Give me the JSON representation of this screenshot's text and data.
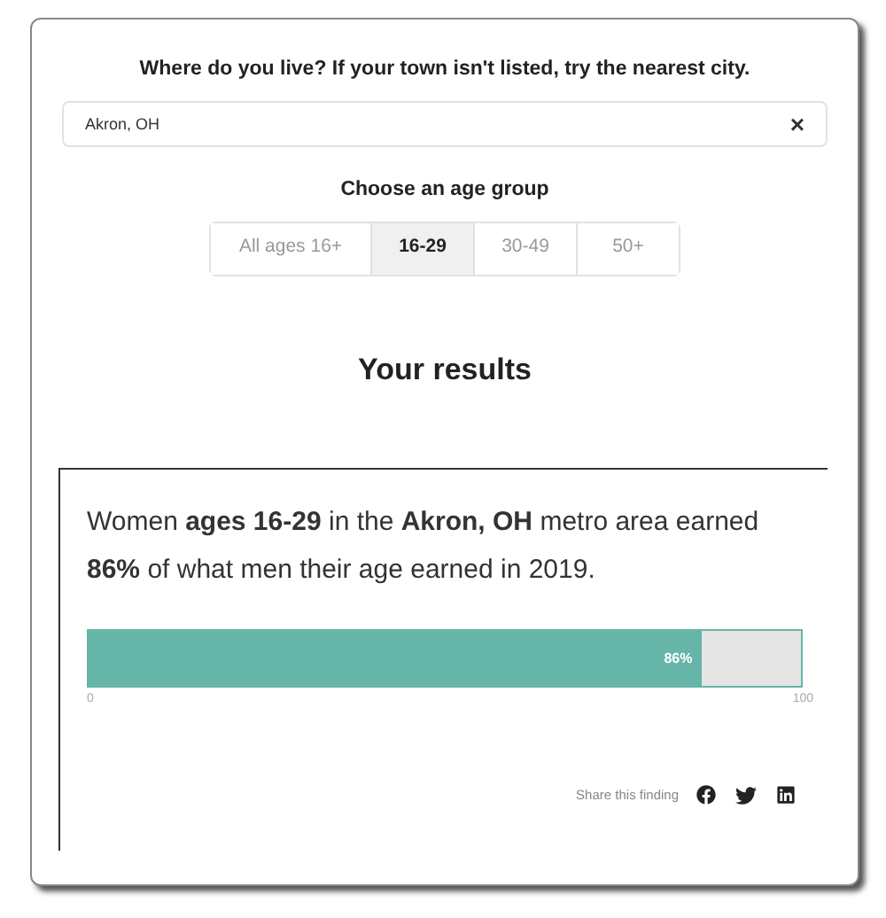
{
  "location": {
    "question": "Where do you live? If your town isn't listed, try the nearest city.",
    "value": "Akron, OH",
    "clear": "×"
  },
  "age_group": {
    "heading": "Choose an age group",
    "options": [
      {
        "label": "All ages 16+",
        "selected": false
      },
      {
        "label": "16-29",
        "selected": true
      },
      {
        "label": "30-49",
        "selected": false
      },
      {
        "label": "50+",
        "selected": false
      }
    ]
  },
  "results": {
    "title": "Your results",
    "sentence": "Women **ages 16-29** in the **Akron, OH** metro area earned **86%** of what men their age earned in 2019.",
    "bar": {
      "level": 0.86,
      "label": "86%",
      "min_label": "0",
      "max_label": "100"
    },
    "share": "Share this finding"
  }
}
